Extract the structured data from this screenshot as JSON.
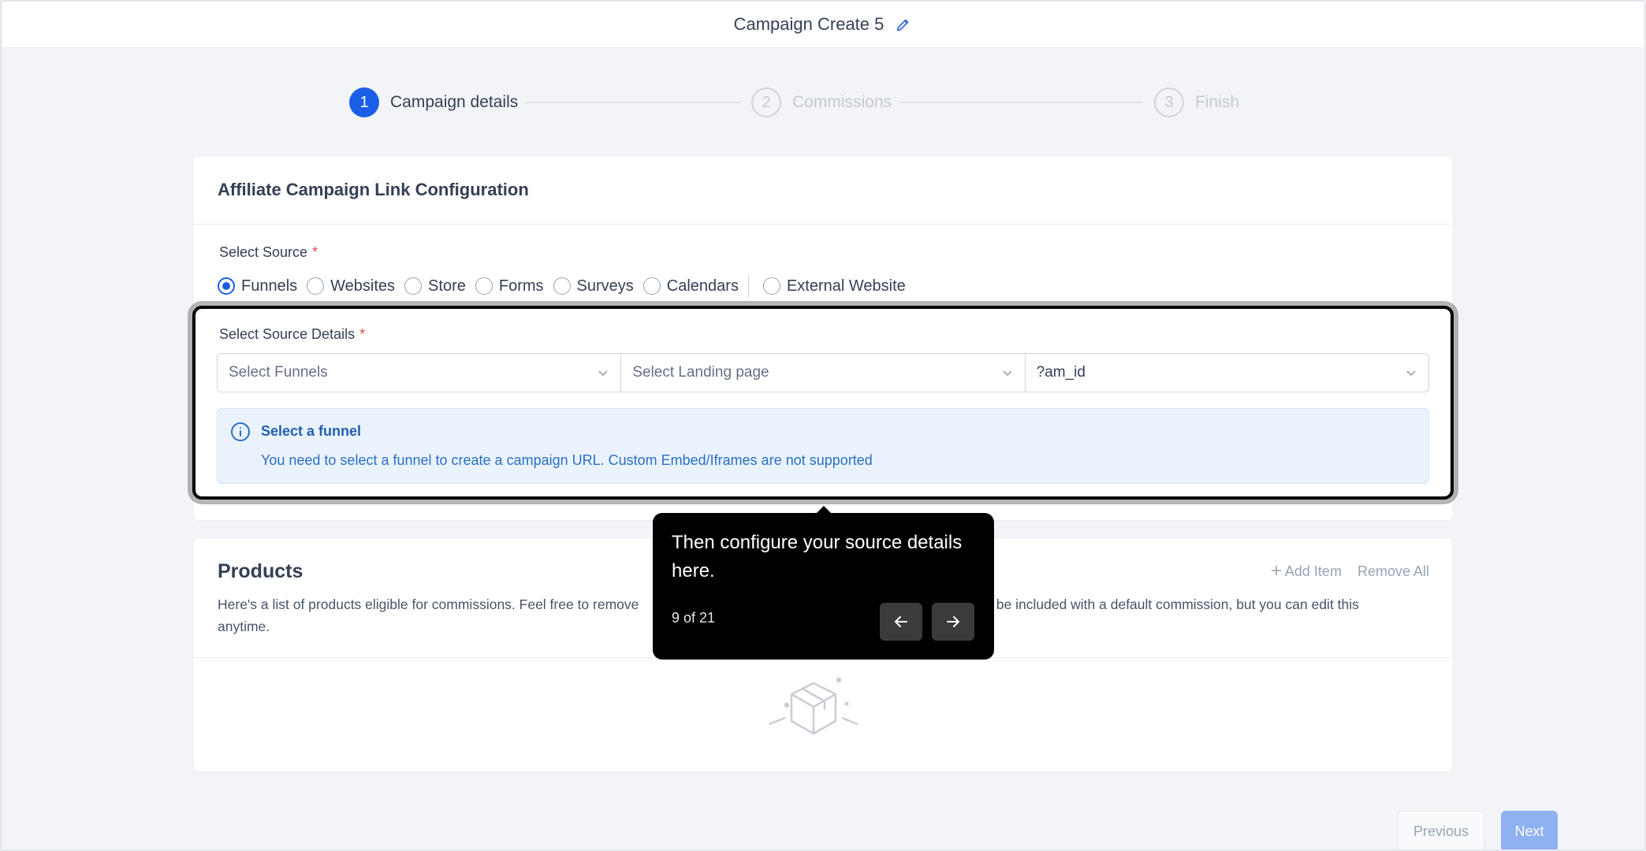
{
  "header": {
    "title": "Campaign Create 5",
    "edit_icon": "pencil-icon"
  },
  "stepper": {
    "steps": [
      {
        "number": "1",
        "label": "Campaign details",
        "state": "active"
      },
      {
        "number": "2",
        "label": "Commissions",
        "state": "inactive"
      },
      {
        "number": "3",
        "label": "Finish",
        "state": "inactive"
      }
    ]
  },
  "link_config": {
    "title": "Affiliate Campaign Link Configuration",
    "source_label": "Select Source",
    "required_mark": "*",
    "sources": [
      "Funnels",
      "Websites",
      "Store",
      "Forms",
      "Surveys",
      "Calendars"
    ],
    "selected_source": "Funnels",
    "external_source": "External Website",
    "details_label": "Select Source Details",
    "funnel_placeholder": "Select Funnels",
    "landing_placeholder": "Select Landing page",
    "param_value": "?am_id",
    "info_title": "Select a funnel",
    "info_text": "You need to select a funnel to create a campaign URL. Custom Embed/Iframes are not supported"
  },
  "products": {
    "title": "Products",
    "add_item": "Add Item",
    "remove_all": "Remove All",
    "desc_visible_start": "Here's a list of products eligible for commissions. Feel free to remove",
    "desc_visible_end": "lly be included with a default commission, but you can edit this",
    "desc_line2": "anytime."
  },
  "tooltip": {
    "message": "Then configure your source details here.",
    "count": "9 of 21"
  },
  "footer": {
    "previous": "Previous",
    "next": "Next"
  },
  "colors": {
    "primary": "#1a5ee8",
    "info_bg": "#eaf3fd",
    "info_text": "#2a6fc4"
  }
}
